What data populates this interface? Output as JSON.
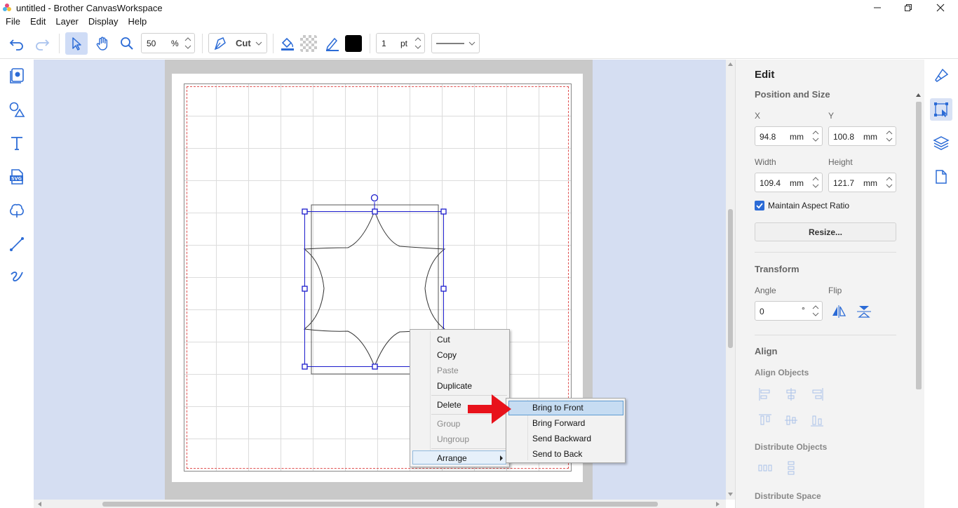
{
  "window": {
    "title": "untitled - Brother CanvasWorkspace",
    "minimize": "—",
    "maximize": "❐",
    "close": "✕"
  },
  "menu": [
    "File",
    "Edit",
    "Layer",
    "Display",
    "Help"
  ],
  "toolbar": {
    "zoom_value": "50",
    "zoom_unit": "%",
    "line_mode": "Cut",
    "stroke_color": "#000000",
    "line_width_value": "1",
    "line_width_unit": "pt"
  },
  "panel": {
    "title": "Edit",
    "position_size": {
      "heading": "Position and Size",
      "x_label": "X",
      "x_value": "94.8",
      "y_label": "Y",
      "y_value": "100.8",
      "width_label": "Width",
      "width_value": "109.4",
      "height_label": "Height",
      "height_value": "121.7",
      "unit": "mm",
      "aspect_label": "Maintain Aspect Ratio",
      "aspect_checked": true,
      "resize_label": "Resize..."
    },
    "transform": {
      "heading": "Transform",
      "angle_label": "Angle",
      "angle_value": "0",
      "angle_unit": "°",
      "flip_label": "Flip"
    },
    "align": {
      "heading": "Align",
      "align_objects": "Align Objects",
      "distribute_objects": "Distribute Objects",
      "distribute_space": "Distribute Space"
    }
  },
  "context_menu": {
    "items": [
      {
        "label": "Cut",
        "enabled": true
      },
      {
        "label": "Copy",
        "enabled": true
      },
      {
        "label": "Paste",
        "enabled": false
      },
      {
        "label": "Duplicate",
        "enabled": true
      },
      {
        "label": "Delete",
        "enabled": true
      },
      {
        "label": "Group",
        "enabled": false
      },
      {
        "label": "Ungroup",
        "enabled": false
      },
      {
        "label": "Arrange",
        "enabled": true
      }
    ],
    "submenu": [
      "Bring to Front",
      "Bring Forward",
      "Send Backward",
      "Send to Back"
    ]
  },
  "colors": {
    "accent": "#1a1aff",
    "selection_handle": "#1a1acc",
    "arrow": "#e8121b",
    "canvas_bg": "#d5def2"
  }
}
